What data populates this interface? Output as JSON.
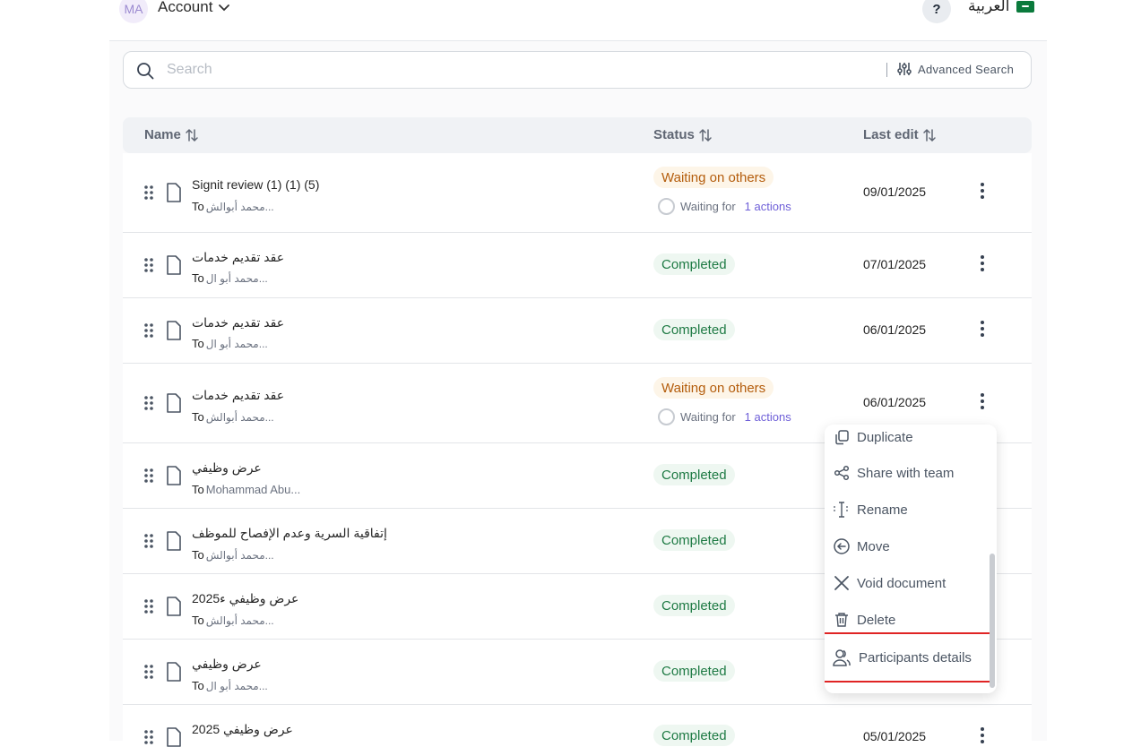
{
  "header": {
    "avatar_initials": "MA",
    "account_label": "Account",
    "help_label": "?",
    "language_label": "العربية"
  },
  "search": {
    "placeholder": "Search",
    "advanced_label": "Advanced Search"
  },
  "table": {
    "columns": {
      "name": "Name",
      "status": "Status",
      "last_edit": "Last edit"
    },
    "to_prefix": "To",
    "rows": [
      {
        "title": "Signit review (1) (1) (5)",
        "recipient": "محمد أبوالش...",
        "status": "Waiting on others",
        "waiting_text": "Waiting for",
        "actions": "1 actions",
        "date": "09/01/2025"
      },
      {
        "title": "عقد تقديم خدمات",
        "recipient": "محمد أبو ال...",
        "status": "Completed",
        "date": "07/01/2025"
      },
      {
        "title": "عقد تقديم خدمات",
        "recipient": "محمد أبو ال...",
        "status": "Completed",
        "date": "06/01/2025"
      },
      {
        "title": "عقد تقديم خدمات",
        "recipient": "محمد أبوالش...",
        "status": "Waiting on others",
        "waiting_text": "Waiting for",
        "actions": "1 actions",
        "date": "06/01/2025"
      },
      {
        "title": "عرض وظيفي",
        "recipient": "Mohammad Abu...",
        "status": "Completed",
        "date": ""
      },
      {
        "title": "إتفاقية السرية وعدم الإفصاح للموظف",
        "recipient": "محمد أبوالش...",
        "status": "Completed",
        "date": ""
      },
      {
        "title": "عرض وظيفي ء2025",
        "recipient": "محمد أبوالش...",
        "status": "Completed",
        "date": ""
      },
      {
        "title": "عرض وظيفي",
        "recipient": "محمد أبو ال...",
        "status": "Completed",
        "date": ""
      },
      {
        "title": "عرض وظيفي 2025",
        "recipient": "",
        "status": "Completed",
        "date": "05/01/2025"
      }
    ]
  },
  "context_menu": {
    "items": [
      "Duplicate",
      "Share with team",
      "Rename",
      "Move",
      "Void document",
      "Delete",
      "Participants details"
    ]
  },
  "colors": {
    "completed_text": "#1e7a44",
    "waiting_text": "#b45d0c",
    "actions_link": "#6e5fd8",
    "highlight_border": "#e02424"
  }
}
